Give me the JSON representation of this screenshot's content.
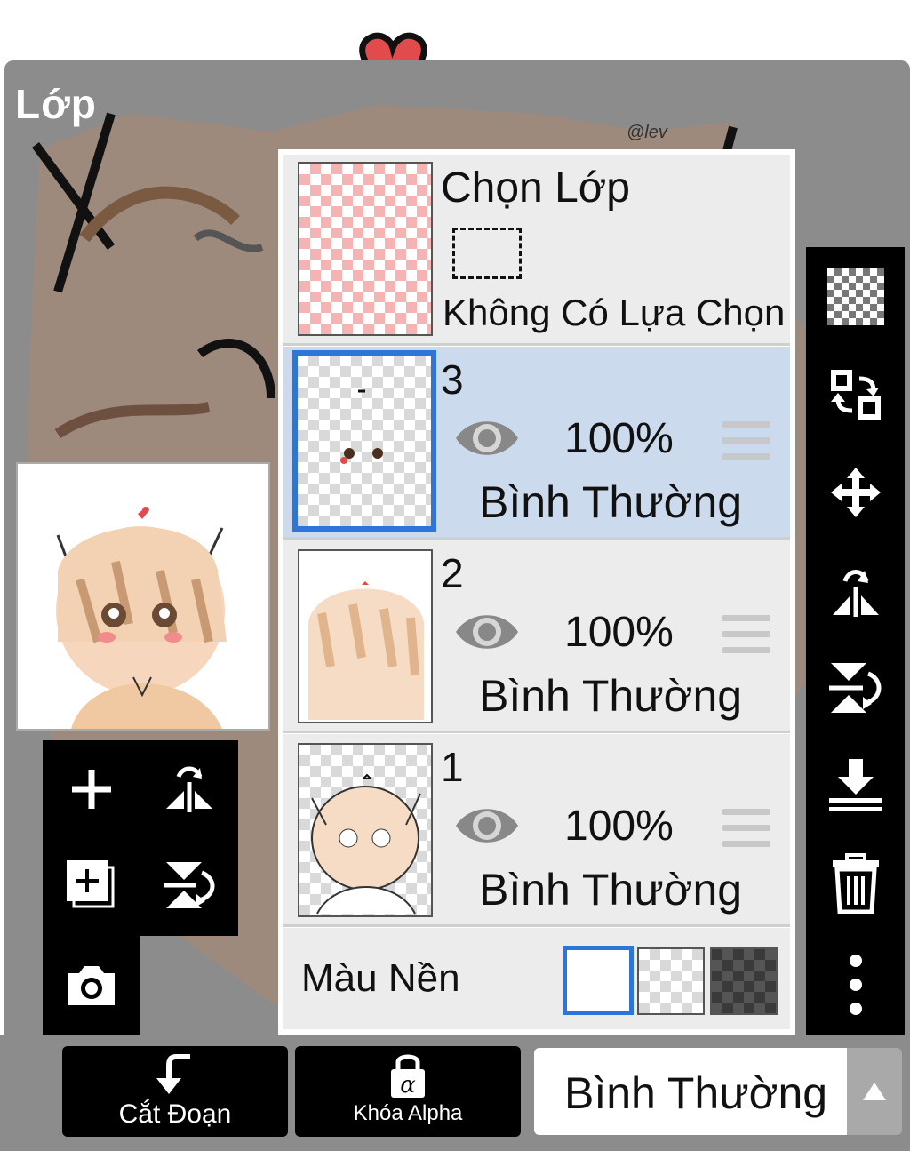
{
  "panel": {
    "title": "Lớp"
  },
  "canvas": {
    "signature": "@lev"
  },
  "selection_row": {
    "title": "Chọn Lớp",
    "status": "Không Có Lựa Chọn"
  },
  "layers": [
    {
      "number": "3",
      "opacity": "100%",
      "blend": "Bình Thường",
      "selected": true
    },
    {
      "number": "2",
      "opacity": "100%",
      "blend": "Bình Thường",
      "selected": false
    },
    {
      "number": "1",
      "opacity": "100%",
      "blend": "Bình Thường",
      "selected": false
    }
  ],
  "background_row": {
    "label": "Màu Nền",
    "options": [
      "white",
      "transparent",
      "dark-checker"
    ],
    "selected": "white"
  },
  "left_tools": [
    "add-layer-icon",
    "flip-horizontal-icon",
    "add-copy-layer-icon",
    "flip-vertical-icon",
    "camera-icon"
  ],
  "right_tools": [
    "transparency-icon",
    "swap-layers-icon",
    "move-icon",
    "flip-horizontal-icon",
    "flip-vertical-icon",
    "merge-down-icon",
    "trash-icon",
    "more-icon"
  ],
  "bottom": {
    "clip_label": "Cắt Đoạn",
    "alpha_lock_label": "Khóa Alpha",
    "blend_mode": "Bình Thường"
  },
  "colors": {
    "accent": "#2f74d9",
    "selected_row": "#ccdaee",
    "panel_bg": "#8c8c8c"
  }
}
